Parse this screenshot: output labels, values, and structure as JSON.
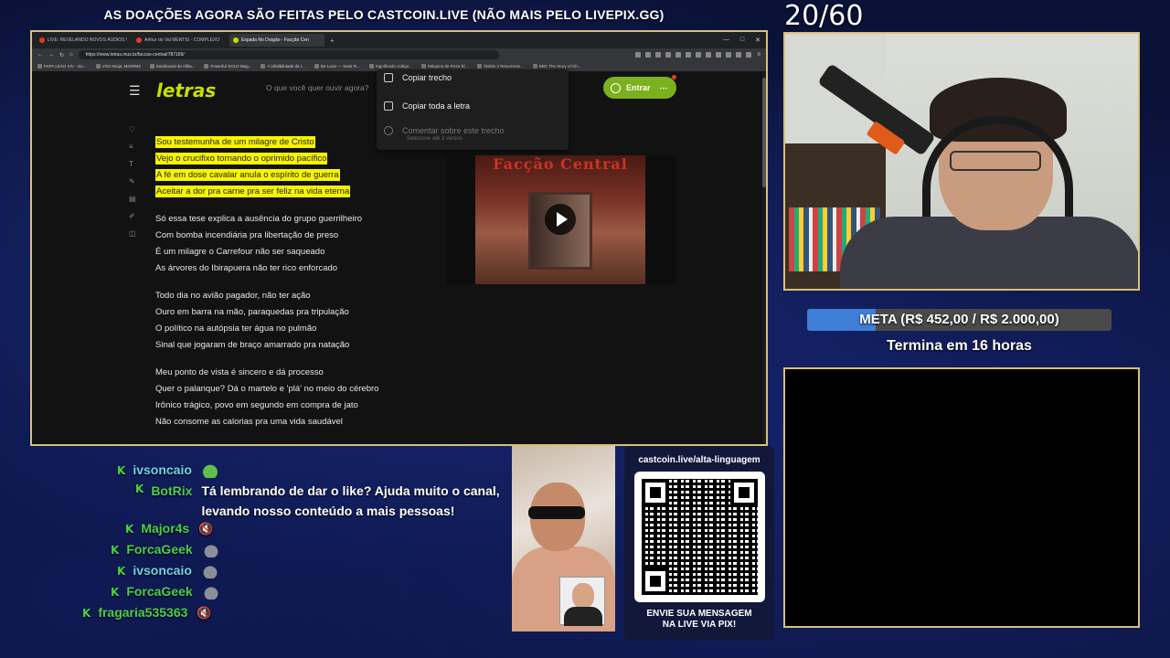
{
  "banner": "AS DOAÇÕES AGORA SÃO FEITAS PELO CASTCOIN.LIVE (NÃO MAIS PELO LIVEPIX.GG)",
  "counter": "20/60",
  "browser": {
    "tabs": [
      {
        "label": "LIVE: REVELANDO NOVOS ÁUDIOS !",
        "active": false
      },
      {
        "label": "Arthur do Val MENTIU - COMPLEXO",
        "active": false
      },
      {
        "label": "Espada No Dragão - Facção Cen",
        "active": true
      }
    ],
    "url": "https://www.letras.mus.br/faccao-central/787189/",
    "bookmarks": [
      "PAPA LEÃO XIV - Go...",
      "VOO.Ninja: MIORM3",
      "Dashboard de Afilia...",
      "Powerful SOLO Mag...",
      "A infalibilidade da I...",
      "De Lacis — Saint R...",
      "Significado código...",
      "Máquina de Rosa El...",
      "Diablo 2 Resurrecte...",
      "BBC The Story of Ch..."
    ],
    "page": {
      "logo": "letras",
      "search_placeholder": "O que você quer ouvir agora?",
      "enter_label": "Entrar",
      "context_menu": [
        {
          "label": "Copiar trecho",
          "disabled": false
        },
        {
          "label": "Copiar toda a letra",
          "disabled": false
        },
        {
          "label": "Comentar sobre este trecho",
          "disabled": true
        }
      ],
      "context_sub": "Selecione até 3 versos",
      "video_title": "Facção Central",
      "lyrics_highlighted": [
        "Sou testemunha de um milagre de Cristo",
        "Vejo o crucifixo tornando o oprimido pacífico",
        "A fé em dose cavalar anula o espírito de guerra",
        "Aceitar a dor pra carne pra ser feliz na vida eterna"
      ],
      "lyrics_stanza2": [
        "Só essa tese explica a ausência do grupo guerrilheiro",
        "Com bomba incendiária pra libertação de preso",
        "É um milagre o Carrefour não ser saqueado",
        "As árvores do Ibirapuera não ter rico enforcado"
      ],
      "lyrics_stanza3": [
        "Todo dia no avião pagador, não ter ação",
        "Ouro em barra na mão, paraquedas pra tripulação",
        "O político na autópsia ter água no pulmão",
        "Sinal que jogaram de braço amarrado pra natação"
      ],
      "lyrics_stanza4": [
        "Meu ponto de vista é sincero e dá processo",
        "Quer o palanque? Dá o martelo e 'plá' no meio do cérebro",
        "Irônico trágico, povo em segundo em compra de jato",
        "Não consome as calorias pra uma vida saudável"
      ]
    }
  },
  "goal": {
    "text": "META (R$ 452,00 / R$ 2.000,00)",
    "progress": 0.226,
    "ends": "Termina em 16 horas"
  },
  "chat": [
    {
      "user": "ivsoncaio",
      "color": "#6fd3e8",
      "text": "",
      "emote": "frog"
    },
    {
      "user": "BotRix",
      "color": "#4ad04a",
      "text": "Tá lembrando de dar o like? Ajuda muito o canal, levando nosso conteúdo a mais pessoas!",
      "emote": ""
    },
    {
      "user": "Major4s",
      "color": "#4ad04a",
      "text": "",
      "emote": "mute"
    },
    {
      "user": "ForcaGeek",
      "color": "#4ad04a",
      "text": "",
      "emote": "seal"
    },
    {
      "user": "ivsoncaio",
      "color": "#6fd3e8",
      "text": "",
      "emote": "seal"
    },
    {
      "user": "ForcaGeek",
      "color": "#4ad04a",
      "text": "",
      "emote": "seal"
    },
    {
      "user": "fragaria535363",
      "color": "#4ad04a",
      "text": "",
      "emote": "mute"
    }
  ],
  "pix": {
    "url": "castcoin.live/alta-linguagem",
    "cta_line1": "ENVIE SUA MENSAGEM",
    "cta_line2": "NA LIVE VIA PIX!"
  }
}
